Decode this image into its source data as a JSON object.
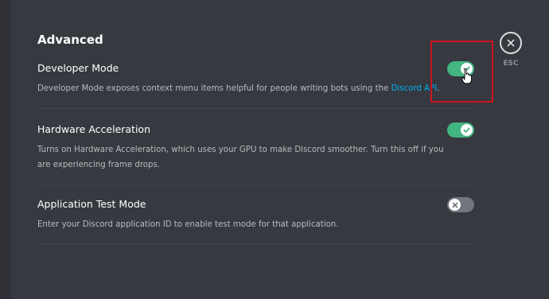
{
  "section": {
    "title": "Advanced"
  },
  "settings": [
    {
      "title": "Developer Mode",
      "desc_prefix": "Developer Mode exposes context menu items helpful for people writing bots using the ",
      "desc_link": "Discord API",
      "desc_suffix": ".",
      "enabled": true
    },
    {
      "title": "Hardware Acceleration",
      "desc": "Turns on Hardware Acceleration, which uses your GPU to make Discord smoother. Turn this off if you are experiencing frame drops.",
      "enabled": true
    },
    {
      "title": "Application Test Mode",
      "desc": "Enter your Discord application ID to enable test mode for that application.",
      "enabled": false
    }
  ],
  "close": {
    "esc_label": "ESC",
    "icon": "close-icon"
  },
  "colors": {
    "toggle_on": "#43b581",
    "toggle_off": "#72767d",
    "link": "#00b0f4",
    "highlight": "#d0131e"
  }
}
